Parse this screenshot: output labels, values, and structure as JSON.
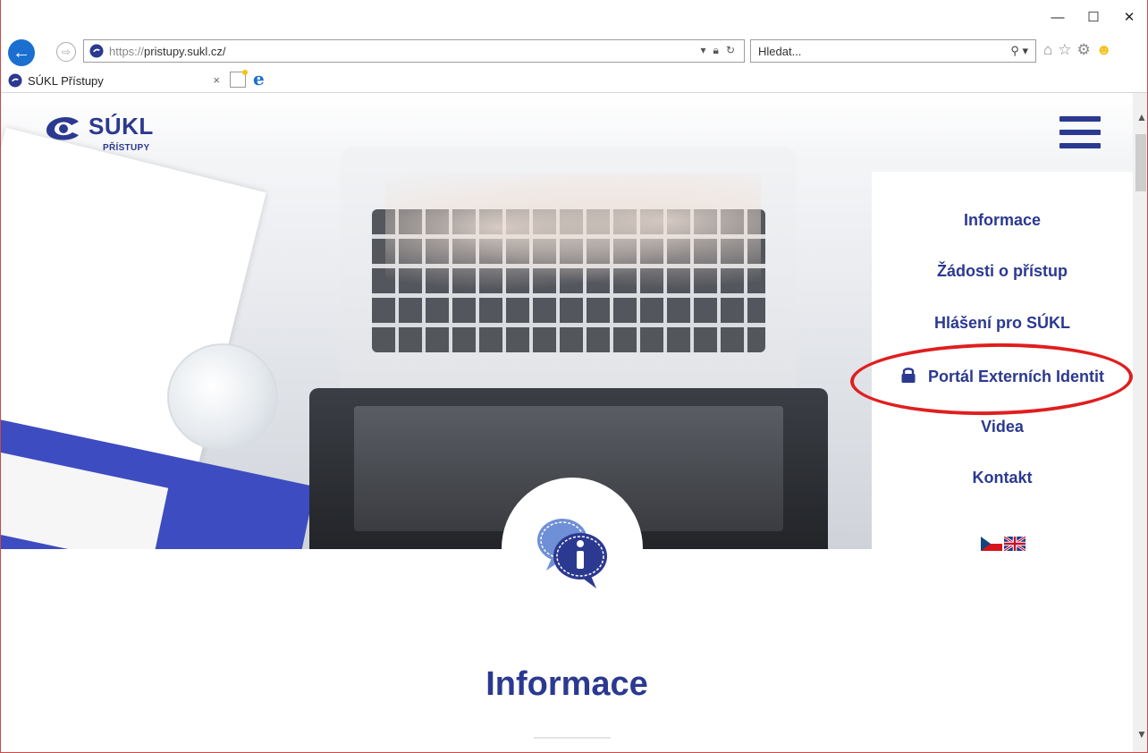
{
  "window": {
    "minimize": "—",
    "maximize": "☐",
    "close": "✕"
  },
  "browser": {
    "address_proto": "https://",
    "address_host": "pristupy.sukl.cz/",
    "search_placeholder": "Hledat...",
    "tab_title": "SÚKL Přístupy",
    "tab_close": "×"
  },
  "site": {
    "logo_text": "SÚKL",
    "logo_sub": "PŘÍSTUPY",
    "menu": [
      {
        "label": "Informace"
      },
      {
        "label": "Žádosti o přístup"
      },
      {
        "label": "Hlášení pro SÚKL"
      },
      {
        "label": "Portál Externích Identit",
        "icon": "lock-icon"
      },
      {
        "label": "Videa"
      },
      {
        "label": "Kontakt"
      }
    ],
    "section_title": "Informace"
  },
  "colors": {
    "brand": "#2b3990",
    "highlight": "#e01e1e",
    "browser_accent": "#1b6fd1"
  }
}
